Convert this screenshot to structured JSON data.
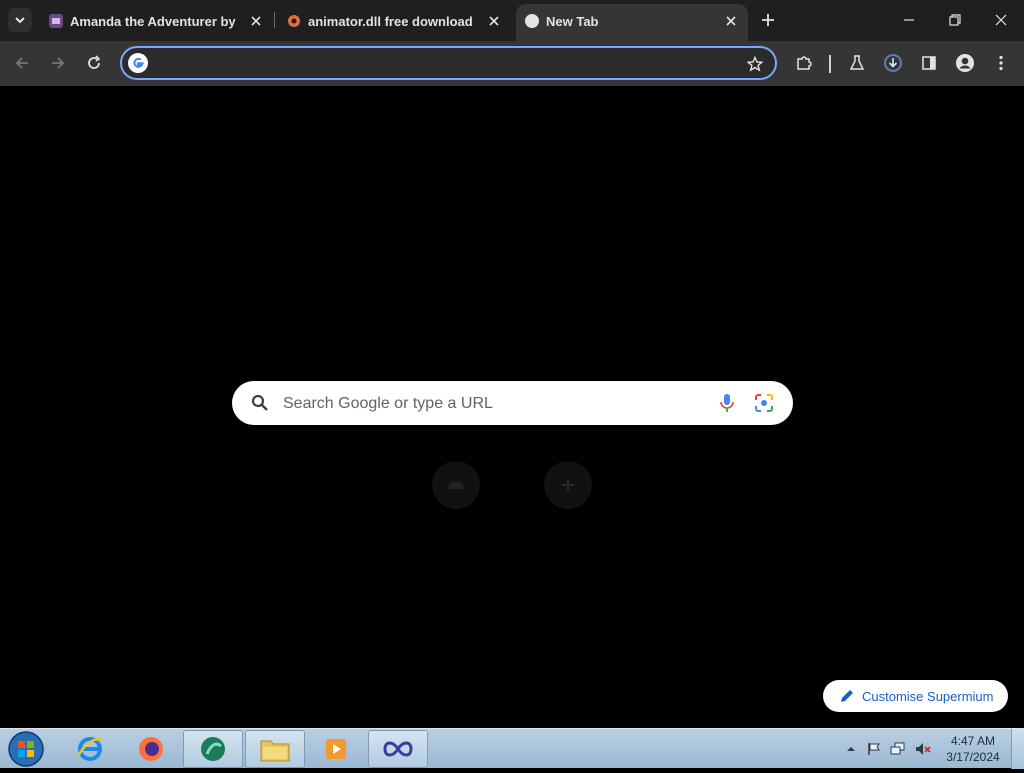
{
  "browser": {
    "tabs": [
      {
        "title": "Amanda the Adventurer by Dr",
        "active": false
      },
      {
        "title": "animator.dll free download | D",
        "active": false
      },
      {
        "title": "New Tab",
        "active": true
      }
    ],
    "omnibox": {
      "value": "",
      "placeholder": ""
    }
  },
  "newtab": {
    "search_placeholder": "Search Google or type a URL",
    "customise_label": "Customise Supermium"
  },
  "taskbar": {
    "clock_time": "4:47 AM",
    "clock_date": "3/17/2024",
    "apps": [
      "internet-explorer",
      "firefox",
      "media-app",
      "file-explorer",
      "media-player",
      "infinity-app"
    ]
  },
  "colors": {
    "tabstrip": "#1f1f1f",
    "toolbar": "#353535",
    "accent": "#7aa7ff",
    "page_bg": "#000000"
  }
}
